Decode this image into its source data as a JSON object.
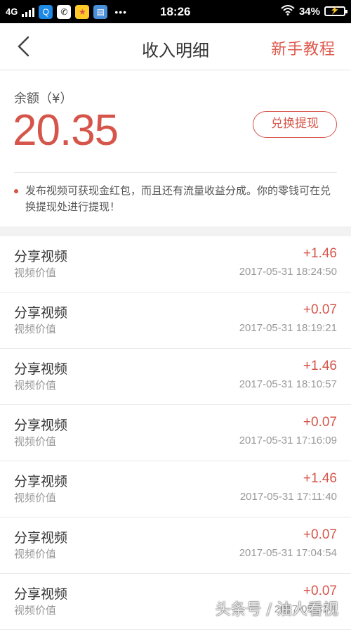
{
  "status_bar": {
    "network": "4G",
    "time": "18:26",
    "battery": "34%",
    "more": "•••",
    "apps": [
      "qq-icon",
      "wechat-icon",
      "star-app-icon",
      "file-app-icon"
    ]
  },
  "header": {
    "title": "收入明细",
    "tutorial_label": "新手教程"
  },
  "balance": {
    "label": "余额（¥）",
    "amount": "20.35",
    "withdraw_label": "兑换提现",
    "notice": "发布视频可获现金红包，而且还有流量收益分成。你的零钱可在兑换提现处进行提现！"
  },
  "records": [
    {
      "title": "分享视频",
      "subtitle": "视频价值",
      "amount": "+1.46",
      "time": "2017-05-31 18:24:50"
    },
    {
      "title": "分享视频",
      "subtitle": "视频价值",
      "amount": "+0.07",
      "time": "2017-05-31 18:19:21"
    },
    {
      "title": "分享视频",
      "subtitle": "视频价值",
      "amount": "+1.46",
      "time": "2017-05-31 18:10:57"
    },
    {
      "title": "分享视频",
      "subtitle": "视频价值",
      "amount": "+0.07",
      "time": "2017-05-31 17:16:09"
    },
    {
      "title": "分享视频",
      "subtitle": "视频价值",
      "amount": "+1.46",
      "time": "2017-05-31 17:11:40"
    },
    {
      "title": "分享视频",
      "subtitle": "视频价值",
      "amount": "+0.07",
      "time": "2017-05-31 17:04:54"
    },
    {
      "title": "分享视频",
      "subtitle": "视频价值",
      "amount": "+0.07",
      "time": "2017-05-31 1"
    }
  ],
  "watermark": "头条号 / 油人看视",
  "colors": {
    "accent": "#d6554a",
    "status_bar": "#000000",
    "background": "#f2f2f2"
  }
}
